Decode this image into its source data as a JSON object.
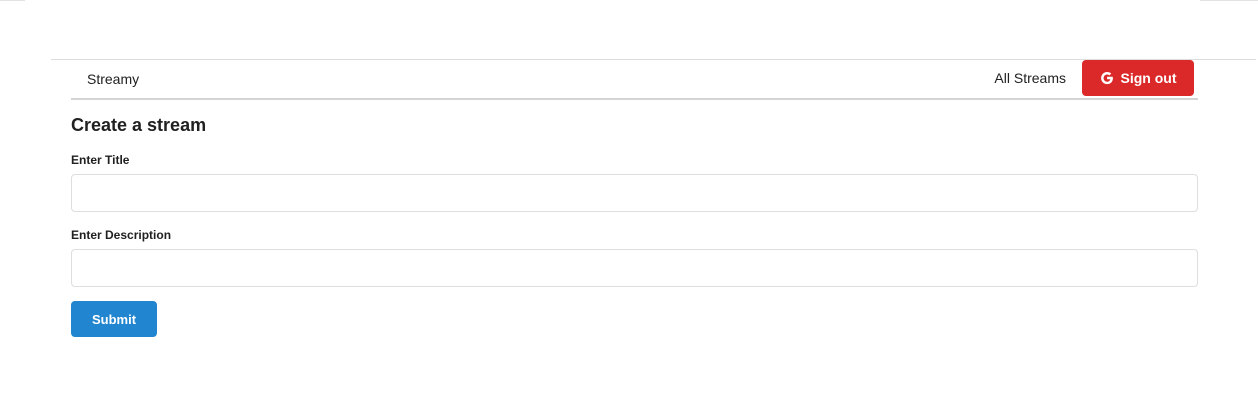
{
  "header": {
    "brand": "Streamy",
    "nav_all_streams": "All Streams",
    "signout_label": "Sign out",
    "signout_icon": "google-icon",
    "signout_color": "#db2828"
  },
  "form": {
    "title": "Create a stream",
    "title_field": {
      "label": "Enter Title",
      "value": "",
      "placeholder": ""
    },
    "description_field": {
      "label": "Enter Description",
      "value": "",
      "placeholder": ""
    },
    "submit_label": "Submit",
    "submit_color": "#2185d0"
  }
}
